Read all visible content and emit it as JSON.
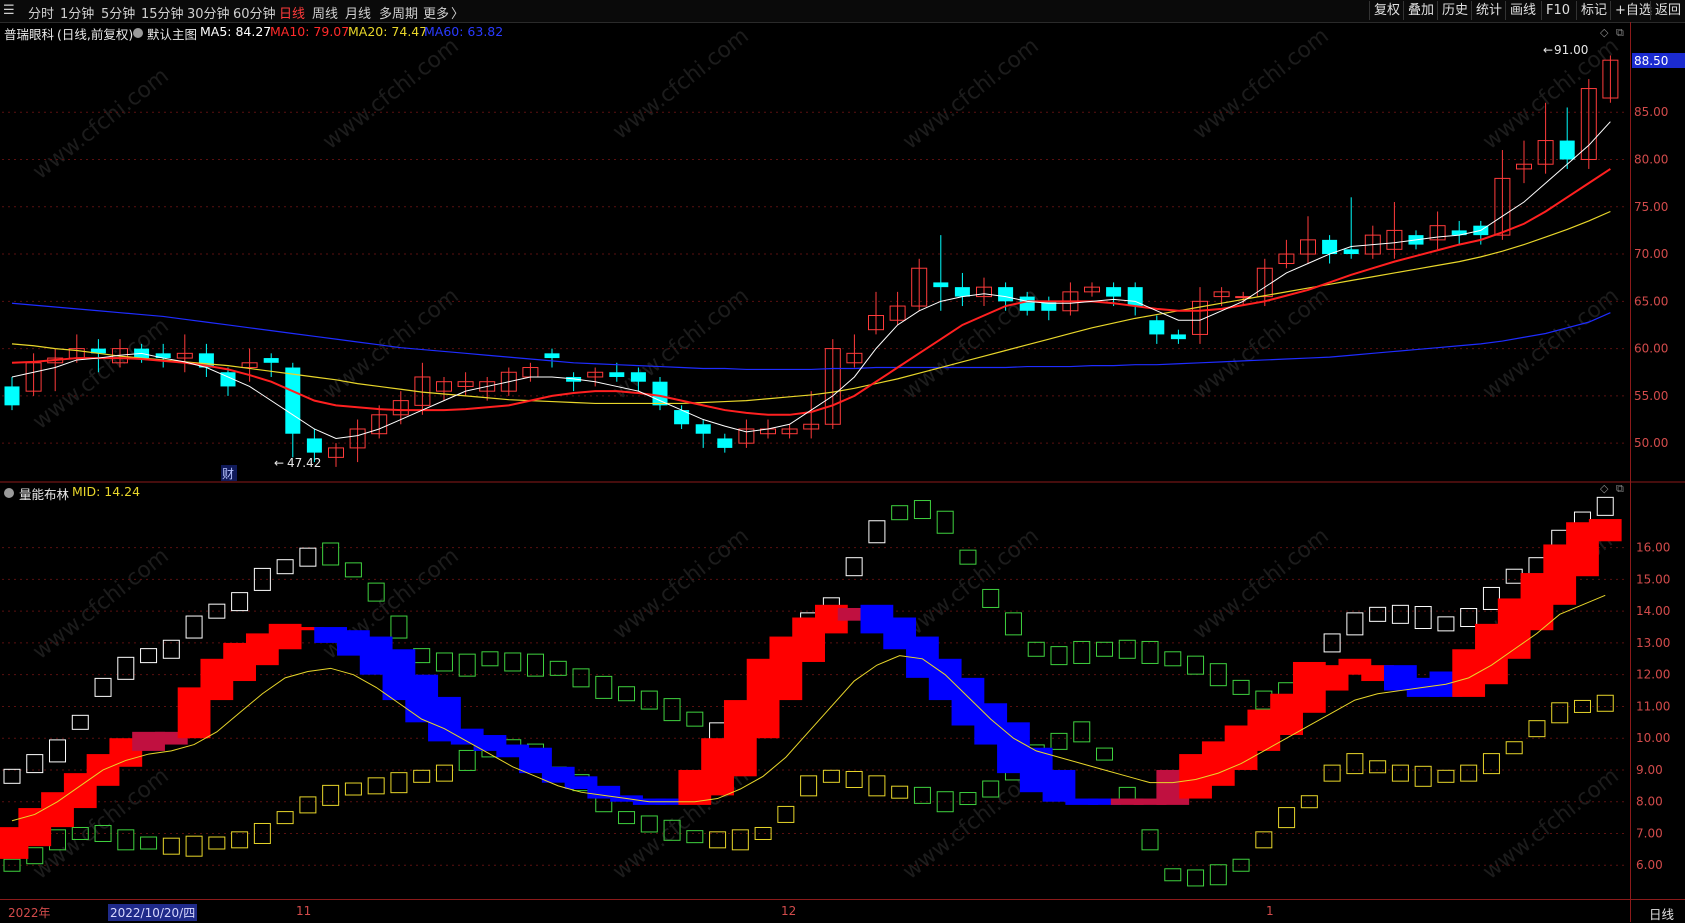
{
  "toolbar": {
    "periods": [
      "分时",
      "1分钟",
      "5分钟",
      "15分钟",
      "30分钟",
      "60分钟",
      "日线",
      "周线",
      "月线",
      "多周期",
      "更多"
    ],
    "active_period": "日线",
    "more_arrow": "〉",
    "tools": [
      "复权",
      "叠加",
      "历史",
      "统计",
      "画线",
      "F10",
      "标记",
      "+自选",
      "返回"
    ]
  },
  "main_chart": {
    "stock_name": "普瑞眼科",
    "period_note": "(日线,前复权)",
    "template": "默认主图",
    "ma5_label": "MA5: 84.27",
    "ma10_label": "MA10: 79.07",
    "ma20_label": "MA20: 74.47",
    "ma60_label": "MA60: 63.82",
    "high_marker": "91.00",
    "low_marker": "47.42",
    "cai_marker": "财",
    "current_price_tag": "88.50",
    "colors": {
      "up": "#ff3b3b",
      "down": "#00ffff",
      "ma5": "#ffffff",
      "ma10": "#ff2020",
      "ma20": "#e8d62a",
      "ma60": "#1e2cff"
    },
    "y_ticks": [
      "85.00",
      "80.00",
      "75.00",
      "70.00",
      "65.00",
      "60.00",
      "55.00",
      "50.00"
    ]
  },
  "sub_chart": {
    "indicator": "量能布林",
    "mid_label": "MID: 14.24",
    "y_ticks": [
      "16.00",
      "15.00",
      "14.00",
      "13.00",
      "12.00",
      "11.00",
      "10.00",
      "9.00",
      "8.00",
      "7.00",
      "6.00"
    ]
  },
  "date_axis": {
    "year_label": "2022年",
    "selected_date": "2022/10/20/四",
    "month_labels": [
      "11",
      "12",
      "1"
    ]
  },
  "period_tag": "日线",
  "watermark": "www.cfchi.com",
  "chart_data": {
    "type": "candlestick",
    "ylim": [
      46,
      92
    ],
    "candles": [
      [
        56.0,
        54.0,
        53.5,
        57.0
      ],
      [
        55.5,
        58.5,
        55.0,
        59.5
      ],
      [
        58.5,
        59.0,
        55.5,
        60.0
      ],
      [
        59.0,
        60.0,
        58.5,
        61.5
      ],
      [
        60.0,
        59.5,
        57.5,
        61.0
      ],
      [
        58.5,
        60.0,
        58.0,
        61.0
      ],
      [
        60.0,
        59.0,
        58.5,
        60.5
      ],
      [
        59.5,
        59.0,
        58.0,
        60.5
      ],
      [
        59.0,
        59.5,
        57.5,
        61.5
      ],
      [
        59.5,
        58.0,
        57.0,
        60.5
      ],
      [
        57.5,
        56.0,
        55.0,
        58.0
      ],
      [
        58.0,
        58.5,
        56.5,
        60.0
      ],
      [
        59.0,
        58.5,
        57.0,
        59.5
      ],
      [
        58.0,
        51.0,
        48.5,
        58.5
      ],
      [
        50.5,
        49.0,
        48.0,
        51.5
      ],
      [
        48.5,
        49.5,
        47.5,
        50.0
      ],
      [
        49.5,
        51.5,
        48.0,
        52.5
      ],
      [
        51.0,
        53.0,
        50.5,
        54.0
      ],
      [
        53.0,
        54.5,
        52.0,
        55.5
      ],
      [
        54.0,
        57.0,
        53.0,
        58.5
      ],
      [
        55.5,
        56.5,
        54.5,
        57.0
      ],
      [
        56.0,
        56.5,
        55.0,
        57.5
      ],
      [
        55.5,
        56.5,
        54.5,
        57.0
      ],
      [
        55.5,
        57.5,
        55.0,
        58.0
      ],
      [
        57.0,
        58.0,
        56.5,
        58.5
      ],
      [
        59.5,
        59.0,
        58.0,
        60.0
      ],
      [
        57.0,
        56.5,
        55.5,
        57.5
      ],
      [
        57.0,
        57.5,
        56.0,
        58.0
      ],
      [
        57.5,
        57.0,
        56.5,
        58.5
      ],
      [
        57.5,
        56.5,
        55.5,
        58.0
      ],
      [
        56.5,
        54.0,
        53.5,
        57.0
      ],
      [
        53.5,
        52.0,
        51.5,
        54.0
      ],
      [
        52.0,
        51.0,
        49.5,
        52.5
      ],
      [
        50.5,
        49.5,
        49.0,
        51.0
      ],
      [
        50.0,
        51.5,
        49.5,
        52.5
      ],
      [
        51.0,
        51.5,
        50.5,
        52.5
      ],
      [
        51.0,
        51.5,
        50.5,
        52.0
      ],
      [
        51.5,
        52.0,
        50.5,
        55.5
      ],
      [
        52.0,
        60.0,
        51.5,
        61.0
      ],
      [
        58.5,
        59.5,
        58.0,
        61.5
      ],
      [
        62.0,
        63.5,
        61.5,
        66.0
      ],
      [
        63.0,
        64.5,
        62.5,
        66.0
      ],
      [
        64.5,
        68.5,
        64.0,
        69.5
      ],
      [
        67.0,
        66.5,
        64.0,
        72.0
      ],
      [
        66.5,
        65.5,
        64.5,
        68.0
      ],
      [
        65.5,
        66.5,
        64.5,
        67.5
      ],
      [
        66.5,
        65.0,
        64.0,
        67.0
      ],
      [
        65.5,
        64.0,
        63.5,
        66.0
      ],
      [
        65.0,
        64.0,
        63.0,
        65.5
      ],
      [
        64.0,
        66.0,
        63.5,
        67.0
      ],
      [
        66.0,
        66.5,
        65.5,
        67.0
      ],
      [
        66.5,
        65.5,
        64.5,
        67.0
      ],
      [
        66.5,
        64.5,
        63.5,
        67.0
      ],
      [
        63.0,
        61.5,
        60.5,
        63.5
      ],
      [
        61.5,
        61.0,
        60.5,
        62.0
      ],
      [
        61.5,
        65.0,
        60.5,
        66.5
      ],
      [
        65.5,
        66.0,
        64.5,
        66.5
      ],
      [
        65.5,
        65.5,
        64.5,
        66.0
      ],
      [
        65.5,
        68.5,
        64.5,
        69.5
      ],
      [
        69.0,
        70.0,
        68.5,
        71.5
      ],
      [
        70.0,
        71.5,
        69.0,
        74.0
      ],
      [
        71.5,
        70.0,
        69.0,
        72.0
      ],
      [
        70.5,
        70.0,
        69.5,
        76.0
      ],
      [
        70.0,
        72.0,
        69.5,
        73.0
      ],
      [
        70.5,
        72.5,
        69.5,
        75.5
      ],
      [
        72.0,
        71.0,
        70.5,
        72.5
      ],
      [
        71.5,
        73.0,
        70.5,
        74.5
      ],
      [
        72.5,
        72.0,
        71.0,
        73.5
      ],
      [
        73.0,
        72.0,
        71.0,
        73.5
      ],
      [
        72.0,
        78.0,
        71.5,
        81.0
      ],
      [
        79.0,
        79.5,
        77.5,
        82.0
      ],
      [
        79.5,
        82.0,
        78.5,
        86.0
      ],
      [
        82.0,
        80.0,
        79.0,
        85.5
      ],
      [
        80.0,
        87.5,
        79.0,
        88.5
      ],
      [
        86.5,
        90.5,
        86.0,
        91.0
      ]
    ],
    "ma5": [
      57.0,
      57.5,
      58.0,
      58.8,
      59.0,
      59.3,
      59.5,
      59.0,
      58.6,
      58.0,
      57.0,
      56.0,
      54.5,
      53.0,
      51.5,
      50.5,
      50.8,
      51.5,
      52.5,
      53.5,
      54.5,
      55.5,
      56.0,
      56.5,
      57.0,
      57.0,
      56.8,
      56.5,
      56.0,
      55.5,
      54.5,
      53.5,
      52.5,
      51.8,
      51.2,
      51.5,
      52.0,
      53.5,
      55.0,
      57.0,
      60.0,
      62.5,
      64.0,
      65.0,
      65.5,
      65.8,
      65.5,
      65.0,
      64.8,
      64.8,
      65.0,
      65.2,
      65.0,
      64.0,
      63.0,
      63.0,
      64.0,
      65.0,
      66.5,
      68.0,
      69.0,
      70.0,
      70.8,
      71.0,
      71.2,
      71.5,
      71.8,
      72.0,
      72.5,
      74.0,
      75.5,
      77.5,
      79.5,
      81.5,
      84.0
    ],
    "ma10": [
      58.5,
      58.6,
      58.8,
      59.0,
      59.0,
      59.0,
      58.9,
      58.7,
      58.5,
      58.2,
      57.8,
      57.2,
      56.5,
      55.5,
      54.5,
      54.0,
      53.8,
      53.6,
      53.5,
      53.5,
      53.5,
      53.6,
      53.8,
      54.0,
      54.5,
      55.0,
      55.3,
      55.5,
      55.5,
      55.3,
      55.0,
      54.5,
      54.0,
      53.5,
      53.2,
      53.0,
      53.0,
      53.3,
      54.0,
      55.0,
      56.5,
      58.0,
      59.5,
      61.0,
      62.5,
      63.5,
      64.5,
      65.0,
      65.0,
      65.0,
      65.0,
      64.8,
      64.5,
      64.2,
      64.0,
      64.0,
      64.2,
      64.6,
      65.0,
      65.6,
      66.2,
      67.0,
      67.8,
      68.5,
      69.2,
      69.8,
      70.4,
      71.0,
      71.5,
      72.3,
      73.2,
      74.5,
      76.0,
      77.5,
      79.0
    ],
    "ma20": [
      60.5,
      60.3,
      60.0,
      59.8,
      59.5,
      59.2,
      59.0,
      58.8,
      58.6,
      58.4,
      58.2,
      57.9,
      57.6,
      57.3,
      57.0,
      56.7,
      56.3,
      56.0,
      55.7,
      55.4,
      55.2,
      55.0,
      54.8,
      54.6,
      54.5,
      54.4,
      54.3,
      54.2,
      54.2,
      54.2,
      54.2,
      54.2,
      54.3,
      54.4,
      54.5,
      54.7,
      54.9,
      55.1,
      55.4,
      55.8,
      56.3,
      56.8,
      57.4,
      58.0,
      58.6,
      59.2,
      59.8,
      60.4,
      61.0,
      61.6,
      62.2,
      62.7,
      63.2,
      63.6,
      64.0,
      64.4,
      64.8,
      65.2,
      65.6,
      66.0,
      66.4,
      66.8,
      67.2,
      67.6,
      68.0,
      68.4,
      68.8,
      69.2,
      69.7,
      70.3,
      71.0,
      71.8,
      72.6,
      73.5,
      74.5
    ],
    "ma60": [
      64.8,
      64.6,
      64.4,
      64.2,
      64.0,
      63.8,
      63.6,
      63.4,
      63.1,
      62.8,
      62.5,
      62.2,
      61.9,
      61.6,
      61.3,
      61.0,
      60.7,
      60.4,
      60.1,
      59.9,
      59.7,
      59.5,
      59.3,
      59.1,
      58.9,
      58.7,
      58.5,
      58.4,
      58.3,
      58.2,
      58.1,
      58.0,
      57.9,
      57.9,
      57.8,
      57.8,
      57.8,
      57.8,
      57.9,
      57.9,
      58.0,
      58.0,
      58.0,
      58.0,
      58.0,
      58.0,
      58.0,
      58.1,
      58.1,
      58.1,
      58.2,
      58.2,
      58.3,
      58.3,
      58.4,
      58.5,
      58.6,
      58.7,
      58.8,
      58.9,
      59.0,
      59.1,
      59.3,
      59.5,
      59.7,
      59.9,
      60.1,
      60.3,
      60.5,
      60.8,
      61.2,
      61.6,
      62.2,
      62.8,
      63.8
    ]
  },
  "sub_data": {
    "ylim": [
      5.0,
      17.5
    ],
    "tr_state": [
      "u",
      "u",
      "u",
      "u",
      "u",
      "u",
      "n",
      "n",
      "u",
      "u",
      "u",
      "u",
      "u",
      "u",
      "d",
      "d",
      "d",
      "d",
      "d",
      "d",
      "d",
      "d",
      "d",
      "d",
      "d",
      "d",
      "d",
      "d",
      "d",
      "d",
      "u",
      "u",
      "u",
      "u",
      "u",
      "u",
      "u",
      "n",
      "d",
      "d",
      "d",
      "d",
      "d",
      "d",
      "d",
      "d",
      "d",
      "d",
      "d",
      "n",
      "n",
      "n",
      "u",
      "u",
      "u",
      "u",
      "u",
      "u",
      "u",
      "u",
      "u",
      "d",
      "d",
      "d",
      "u",
      "u",
      "u",
      "u",
      "u",
      "u",
      "u"
    ],
    "tr": [
      [
        6.2,
        7.2
      ],
      [
        6.6,
        7.8
      ],
      [
        7.2,
        8.3
      ],
      [
        7.8,
        8.9
      ],
      [
        8.5,
        9.5
      ],
      [
        9.1,
        10.0
      ],
      [
        9.6,
        10.2
      ],
      [
        9.8,
        10.2
      ],
      [
        10.0,
        11.6
      ],
      [
        11.2,
        12.5
      ],
      [
        11.8,
        13.0
      ],
      [
        12.3,
        13.3
      ],
      [
        12.8,
        13.6
      ],
      [
        13.4,
        13.5
      ],
      [
        13.0,
        13.5
      ],
      [
        12.6,
        13.4
      ],
      [
        12.0,
        13.2
      ],
      [
        11.2,
        12.8
      ],
      [
        10.5,
        12.0
      ],
      [
        9.9,
        11.3
      ],
      [
        9.8,
        10.3
      ],
      [
        9.6,
        10.1
      ],
      [
        9.4,
        9.8
      ],
      [
        8.9,
        9.7
      ],
      [
        8.6,
        9.1
      ],
      [
        8.4,
        8.8
      ],
      [
        8.1,
        8.5
      ],
      [
        8.0,
        8.2
      ],
      [
        7.9,
        8.1
      ],
      [
        7.9,
        8.1
      ],
      [
        7.9,
        9.0
      ],
      [
        8.2,
        10.0
      ],
      [
        8.8,
        11.2
      ],
      [
        10.0,
        12.5
      ],
      [
        11.2,
        13.2
      ],
      [
        12.4,
        13.8
      ],
      [
        13.3,
        14.2
      ],
      [
        13.7,
        14.1
      ],
      [
        13.3,
        14.2
      ],
      [
        12.8,
        13.8
      ],
      [
        11.9,
        13.2
      ],
      [
        11.2,
        12.5
      ],
      [
        10.4,
        11.9
      ],
      [
        9.8,
        11.1
      ],
      [
        8.9,
        10.5
      ],
      [
        8.3,
        9.7
      ],
      [
        8.0,
        9.0
      ],
      [
        7.9,
        8.1
      ],
      [
        7.9,
        8.1
      ],
      [
        7.9,
        8.1
      ],
      [
        7.9,
        8.1
      ],
      [
        7.9,
        9.0
      ],
      [
        8.1,
        9.5
      ],
      [
        8.5,
        9.9
      ],
      [
        9.0,
        10.4
      ],
      [
        9.6,
        10.9
      ],
      [
        10.1,
        11.4
      ],
      [
        10.8,
        12.4
      ],
      [
        11.5,
        12.3
      ],
      [
        12.0,
        12.5
      ],
      [
        11.8,
        12.3
      ],
      [
        11.5,
        12.3
      ],
      [
        11.3,
        11.9
      ],
      [
        11.3,
        12.1
      ],
      [
        11.3,
        12.8
      ],
      [
        11.7,
        13.6
      ],
      [
        12.5,
        14.4
      ],
      [
        13.4,
        15.2
      ],
      [
        14.2,
        16.1
      ],
      [
        15.1,
        16.8
      ],
      [
        16.2,
        16.9
      ]
    ],
    "upper": [
      8.8,
      9.2,
      9.6,
      10.5,
      11.6,
      12.2,
      12.6,
      12.8,
      13.5,
      14.0,
      14.3,
      15.0,
      15.4,
      15.7,
      15.8,
      15.3,
      14.6,
      13.5,
      12.6,
      12.4,
      12.3,
      12.5,
      12.4,
      12.3,
      12.2,
      11.9,
      11.6,
      11.4,
      11.2,
      10.9,
      10.6,
      10.2,
      10.8,
      11.8,
      12.5,
      13.6,
      14.2,
      15.4,
      16.5,
      17.1,
      17.2,
      16.8,
      15.7,
      14.4,
      13.6,
      12.8,
      12.6,
      12.7,
      12.8,
      12.8,
      12.7,
      12.5,
      12.3,
      12.0,
      11.6,
      11.2,
      11.4,
      12.0,
      13.0,
      13.6,
      13.9,
      13.9,
      13.8,
      13.6,
      13.8,
      14.4,
      15.1,
      15.4,
      16.2,
      16.9,
      17.3
    ],
    "lower": [
      6.0,
      6.3,
      6.8,
      7.0,
      7.0,
      6.8,
      6.7,
      6.6,
      6.6,
      6.7,
      6.8,
      7.0,
      7.5,
      7.9,
      8.2,
      8.4,
      8.5,
      8.6,
      8.8,
      8.9,
      9.3,
      9.6,
      9.7,
      9.5,
      8.9,
      8.6,
      8.0,
      7.5,
      7.3,
      7.1,
      6.9,
      6.8,
      6.8,
      7.0,
      7.6,
      8.5,
      8.8,
      8.7,
      8.5,
      8.3,
      8.2,
      8.0,
      8.1,
      8.4,
      9.0,
      9.6,
      9.9,
      10.2,
      9.5,
      8.2,
      6.8,
      5.7,
      5.6,
      5.7,
      6.0,
      6.8,
      7.5,
      8.0,
      8.9,
      9.2,
      9.1,
      8.9,
      8.8,
      8.8,
      8.9,
      9.2,
      9.7,
      10.3,
      10.8,
      11.0,
      11.1
    ],
    "mid": [
      7.4,
      7.6,
      8.0,
      8.5,
      9.0,
      9.3,
      9.5,
      9.6,
      9.8,
      10.2,
      10.8,
      11.4,
      11.9,
      12.1,
      12.2,
      12.0,
      11.6,
      11.1,
      10.6,
      10.3,
      9.9,
      9.5,
      9.1,
      8.8,
      8.5,
      8.3,
      8.2,
      8.1,
      8.0,
      8.0,
      8.0,
      8.1,
      8.4,
      8.8,
      9.4,
      10.2,
      11.0,
      11.8,
      12.3,
      12.6,
      12.5,
      12.0,
      11.3,
      10.6,
      10.0,
      9.6,
      9.4,
      9.2,
      9.0,
      8.8,
      8.6,
      8.6,
      8.7,
      8.9,
      9.2,
      9.6,
      10.0,
      10.4,
      10.8,
      11.2,
      11.4,
      11.5,
      11.6,
      11.7,
      11.9,
      12.3,
      12.8,
      13.3,
      13.9,
      14.2,
      14.5
    ]
  }
}
